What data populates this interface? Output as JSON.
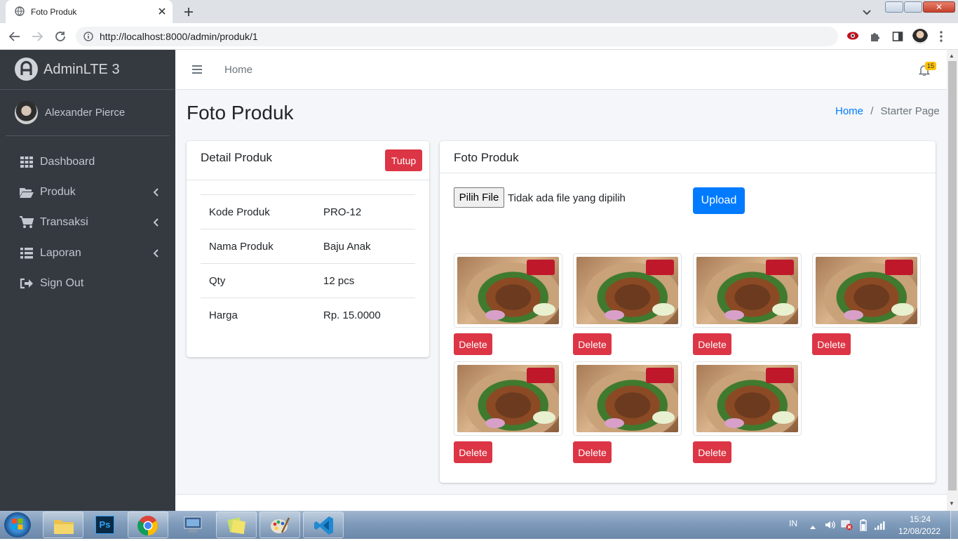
{
  "browser": {
    "tab_title": "Foto Produk",
    "url": "http://localhost:8000/admin/produk/1",
    "window_controls": [
      "minimize",
      "maximize",
      "close"
    ]
  },
  "sidebar": {
    "brand": "AdminLTE 3",
    "user_name": "Alexander Pierce",
    "items": [
      {
        "label": "Dashboard",
        "icon": "grid-icon"
      },
      {
        "label": "Produk",
        "icon": "folder-open-icon"
      },
      {
        "label": "Transaksi",
        "icon": "cart-icon"
      },
      {
        "label": "Laporan",
        "icon": "list-icon"
      },
      {
        "label": "Sign Out",
        "icon": "sign-out-icon"
      }
    ]
  },
  "navbar": {
    "home_link": "Home",
    "notification_count": "15"
  },
  "page": {
    "title": "Foto Produk",
    "breadcrumb": {
      "home": "Home",
      "separator": "/",
      "current": "Starter Page"
    }
  },
  "detail_card": {
    "title": "Detail Produk",
    "close_button": "Tutup",
    "rows": [
      {
        "label": "Kode Produk",
        "value": "PRO-12"
      },
      {
        "label": "Nama Produk",
        "value": "Baju Anak"
      },
      {
        "label": "Qty",
        "value": "12 pcs"
      },
      {
        "label": "Harga",
        "value": "Rp. 15.0000"
      }
    ]
  },
  "photo_card": {
    "title": "Foto Produk",
    "file_button": "Pilih File",
    "file_status": "Tidak ada file yang dipilih",
    "upload_button": "Upload",
    "delete_label": "Delete",
    "photo_count": 7
  },
  "taskbar": {
    "language": "IN",
    "time": "15:24",
    "date": "12/08/2022"
  },
  "colors": {
    "sidebar_bg": "#343a40",
    "primary": "#007bff",
    "danger": "#dc3545",
    "badge_warning": "#ffc107"
  }
}
